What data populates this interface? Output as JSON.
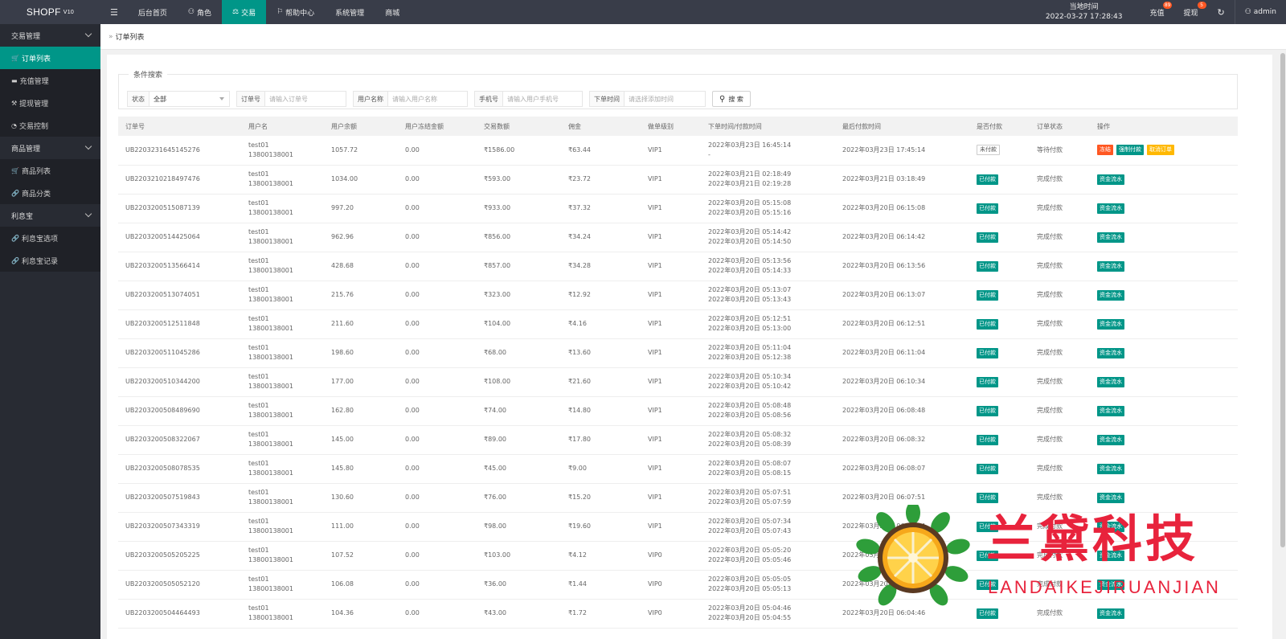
{
  "app": {
    "logo": "SHOPF",
    "version": "V10"
  },
  "topnav": {
    "items": [
      {
        "label": "后台首页",
        "icon": ""
      },
      {
        "label": "角色",
        "icon": "user-icon"
      },
      {
        "label": "交易",
        "icon": "scale-icon",
        "active": true
      },
      {
        "label": "帮助中心",
        "icon": "flag-icon"
      },
      {
        "label": "系统管理",
        "icon": ""
      },
      {
        "label": "商城",
        "icon": ""
      }
    ],
    "clock_label": "当地时间",
    "clock_value": "2022-03-27 17:28:43",
    "recharge_label": "充值",
    "recharge_badge": "89",
    "withdraw_label": "提现",
    "withdraw_badge": "5",
    "user_label": "admin"
  },
  "sidebar": {
    "groups": [
      {
        "label": "交易管理",
        "items": [
          {
            "label": "订单列表",
            "icon": "cart-icon",
            "active": true
          },
          {
            "label": "充值管理",
            "icon": "card-icon"
          },
          {
            "label": "提现管理",
            "icon": "hammer-icon"
          },
          {
            "label": "交易控制",
            "icon": "gauge-icon"
          }
        ]
      },
      {
        "label": "商品管理",
        "items": [
          {
            "label": "商品列表",
            "icon": "cart-icon"
          },
          {
            "label": "商品分类",
            "icon": "link-icon"
          }
        ]
      },
      {
        "label": "利息宝",
        "items": [
          {
            "label": "利息宝选项",
            "icon": "link-icon"
          },
          {
            "label": "利息宝记录",
            "icon": "link-icon"
          }
        ]
      }
    ]
  },
  "breadcrumb": {
    "current": "订单列表"
  },
  "search": {
    "legend": "条件搜索",
    "status_label": "状态",
    "status_value": "全部",
    "order_label": "订单号",
    "order_placeholder": "请输入订单号",
    "username_label": "用户名称",
    "username_placeholder": "请输入用户名称",
    "phone_label": "手机号",
    "phone_placeholder": "请输入用户手机号",
    "time_label": "下单时间",
    "time_placeholder": "请选择添加时间",
    "button_label": "搜 索"
  },
  "table": {
    "headers": [
      "订单号",
      "用户名",
      "用户余额",
      "用户冻结金额",
      "交易数额",
      "佣金",
      "做单级别",
      "下单时间/付款时间",
      "最后付款时间",
      "是否付款",
      "订单状态",
      "操作"
    ],
    "rows": [
      {
        "id": "UB2203231645145276",
        "user": "test01",
        "phone": "13800138001",
        "balance": "1057.72",
        "frozen": "0.00",
        "amount": "₹1586.00",
        "commission": "₹63.44",
        "level": "VIP1",
        "t1": "2022年03月23日 16:45:14",
        "t2": "-",
        "last": "2022年03月23日 17:45:14",
        "paid": "未付款",
        "status": "等待付款",
        "actions": [
          "冻结",
          "强制付款",
          "取消订单"
        ]
      },
      {
        "id": "UB2203210218497476",
        "user": "test01",
        "phone": "13800138001",
        "balance": "1034.00",
        "frozen": "0.00",
        "amount": "₹593.00",
        "commission": "₹23.72",
        "level": "VIP1",
        "t1": "2022年03月21日 02:18:49",
        "t2": "2022年03月21日 02:19:28",
        "last": "2022年03月21日 03:18:49",
        "paid": "已付款",
        "status": "完成付款",
        "actions": [
          "资金流水"
        ]
      },
      {
        "id": "UB2203200515087139",
        "user": "test01",
        "phone": "13800138001",
        "balance": "997.20",
        "frozen": "0.00",
        "amount": "₹933.00",
        "commission": "₹37.32",
        "level": "VIP1",
        "t1": "2022年03月20日 05:15:08",
        "t2": "2022年03月20日 05:15:16",
        "last": "2022年03月20日 06:15:08",
        "paid": "已付款",
        "status": "完成付款",
        "actions": [
          "资金流水"
        ]
      },
      {
        "id": "UB2203200514425064",
        "user": "test01",
        "phone": "13800138001",
        "balance": "962.96",
        "frozen": "0.00",
        "amount": "₹856.00",
        "commission": "₹34.24",
        "level": "VIP1",
        "t1": "2022年03月20日 05:14:42",
        "t2": "2022年03月20日 05:14:50",
        "last": "2022年03月20日 06:14:42",
        "paid": "已付款",
        "status": "完成付款",
        "actions": [
          "资金流水"
        ]
      },
      {
        "id": "UB2203200513566414",
        "user": "test01",
        "phone": "13800138001",
        "balance": "428.68",
        "frozen": "0.00",
        "amount": "₹857.00",
        "commission": "₹34.28",
        "level": "VIP1",
        "t1": "2022年03月20日 05:13:56",
        "t2": "2022年03月20日 05:14:33",
        "last": "2022年03月20日 06:13:56",
        "paid": "已付款",
        "status": "完成付款",
        "actions": [
          "资金流水"
        ]
      },
      {
        "id": "UB2203200513074051",
        "user": "test01",
        "phone": "13800138001",
        "balance": "215.76",
        "frozen": "0.00",
        "amount": "₹323.00",
        "commission": "₹12.92",
        "level": "VIP1",
        "t1": "2022年03月20日 05:13:07",
        "t2": "2022年03月20日 05:13:43",
        "last": "2022年03月20日 06:13:07",
        "paid": "已付款",
        "status": "完成付款",
        "actions": [
          "资金流水"
        ]
      },
      {
        "id": "UB2203200512511848",
        "user": "test01",
        "phone": "13800138001",
        "balance": "211.60",
        "frozen": "0.00",
        "amount": "₹104.00",
        "commission": "₹4.16",
        "level": "VIP1",
        "t1": "2022年03月20日 05:12:51",
        "t2": "2022年03月20日 05:13:00",
        "last": "2022年03月20日 06:12:51",
        "paid": "已付款",
        "status": "完成付款",
        "actions": [
          "资金流水"
        ]
      },
      {
        "id": "UB2203200511045286",
        "user": "test01",
        "phone": "13800138001",
        "balance": "198.60",
        "frozen": "0.00",
        "amount": "₹68.00",
        "commission": "₹13.60",
        "level": "VIP1",
        "t1": "2022年03月20日 05:11:04",
        "t2": "2022年03月20日 05:12:38",
        "last": "2022年03月20日 06:11:04",
        "paid": "已付款",
        "status": "完成付款",
        "actions": [
          "资金流水"
        ]
      },
      {
        "id": "UB2203200510344200",
        "user": "test01",
        "phone": "13800138001",
        "balance": "177.00",
        "frozen": "0.00",
        "amount": "₹108.00",
        "commission": "₹21.60",
        "level": "VIP1",
        "t1": "2022年03月20日 05:10:34",
        "t2": "2022年03月20日 05:10:42",
        "last": "2022年03月20日 06:10:34",
        "paid": "已付款",
        "status": "完成付款",
        "actions": [
          "资金流水"
        ]
      },
      {
        "id": "UB2203200508489690",
        "user": "test01",
        "phone": "13800138001",
        "balance": "162.80",
        "frozen": "0.00",
        "amount": "₹74.00",
        "commission": "₹14.80",
        "level": "VIP1",
        "t1": "2022年03月20日 05:08:48",
        "t2": "2022年03月20日 05:08:56",
        "last": "2022年03月20日 06:08:48",
        "paid": "已付款",
        "status": "完成付款",
        "actions": [
          "资金流水"
        ]
      },
      {
        "id": "UB2203200508322067",
        "user": "test01",
        "phone": "13800138001",
        "balance": "145.00",
        "frozen": "0.00",
        "amount": "₹89.00",
        "commission": "₹17.80",
        "level": "VIP1",
        "t1": "2022年03月20日 05:08:32",
        "t2": "2022年03月20日 05:08:39",
        "last": "2022年03月20日 06:08:32",
        "paid": "已付款",
        "status": "完成付款",
        "actions": [
          "资金流水"
        ]
      },
      {
        "id": "UB2203200508078535",
        "user": "test01",
        "phone": "13800138001",
        "balance": "145.80",
        "frozen": "0.00",
        "amount": "₹45.00",
        "commission": "₹9.00",
        "level": "VIP1",
        "t1": "2022年03月20日 05:08:07",
        "t2": "2022年03月20日 05:08:15",
        "last": "2022年03月20日 06:08:07",
        "paid": "已付款",
        "status": "完成付款",
        "actions": [
          "资金流水"
        ]
      },
      {
        "id": "UB2203200507519843",
        "user": "test01",
        "phone": "13800138001",
        "balance": "130.60",
        "frozen": "0.00",
        "amount": "₹76.00",
        "commission": "₹15.20",
        "level": "VIP1",
        "t1": "2022年03月20日 05:07:51",
        "t2": "2022年03月20日 05:07:59",
        "last": "2022年03月20日 06:07:51",
        "paid": "已付款",
        "status": "完成付款",
        "actions": [
          "资金流水"
        ]
      },
      {
        "id": "UB2203200507343319",
        "user": "test01",
        "phone": "13800138001",
        "balance": "111.00",
        "frozen": "0.00",
        "amount": "₹98.00",
        "commission": "₹19.60",
        "level": "VIP1",
        "t1": "2022年03月20日 05:07:34",
        "t2": "2022年03月20日 05:07:43",
        "last": "2022年03月20日 06:07:34",
        "paid": "已付款",
        "status": "完成付款",
        "actions": [
          "资金流水"
        ]
      },
      {
        "id": "UB2203200505205225",
        "user": "test01",
        "phone": "13800138001",
        "balance": "107.52",
        "frozen": "0.00",
        "amount": "₹103.00",
        "commission": "₹4.12",
        "level": "VIP0",
        "t1": "2022年03月20日 05:05:20",
        "t2": "2022年03月20日 05:05:46",
        "last": "2022年03月20日 06:05:20",
        "paid": "已付款",
        "status": "完成付款",
        "actions": [
          "资金流水"
        ]
      },
      {
        "id": "UB2203200505052120",
        "user": "test01",
        "phone": "13800138001",
        "balance": "106.08",
        "frozen": "0.00",
        "amount": "₹36.00",
        "commission": "₹1.44",
        "level": "VIP0",
        "t1": "2022年03月20日 05:05:05",
        "t2": "2022年03月20日 05:05:13",
        "last": "2022年03月20日 06:05:05",
        "paid": "已付款",
        "status": "完成付款",
        "actions": [
          "资金流水"
        ]
      },
      {
        "id": "UB2203200504464493",
        "user": "test01",
        "phone": "13800138001",
        "balance": "104.36",
        "frozen": "0.00",
        "amount": "₹43.00",
        "commission": "₹1.72",
        "level": "VIP0",
        "t1": "2022年03月20日 05:04:46",
        "t2": "2022年03月20日 05:04:55",
        "last": "2022年03月20日 06:04:46",
        "paid": "已付款",
        "status": "完成付款",
        "actions": [
          "资金流水"
        ]
      }
    ]
  },
  "watermark": {
    "title": "兰黛科技",
    "subtitle": "LANDAIKEJIRUANJIAN"
  },
  "colors": {
    "topbar": "#393d49",
    "sidebar": "#282b33",
    "accent": "#009688",
    "danger": "#ff5722",
    "warning": "#ffb800",
    "watermark": "#e8233c"
  }
}
